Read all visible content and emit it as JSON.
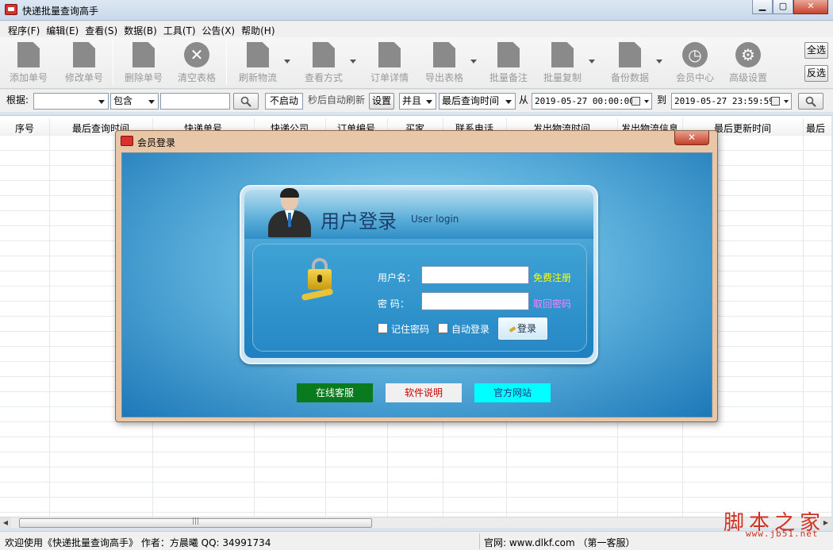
{
  "window": {
    "title": "快递批量查询高手"
  },
  "menu": [
    "程序(F)",
    "编辑(E)",
    "查看(S)",
    "数据(B)",
    "工具(T)",
    "公告(X)",
    "帮助(H)"
  ],
  "toolbar": {
    "add": "添加单号",
    "edit": "修改单号",
    "delete": "删除单号",
    "clear": "清空表格",
    "refresh": "刷新物流",
    "view_mode": "查看方式",
    "order_detail": "订单详情",
    "export": "导出表格",
    "batch_note": "批量备注",
    "batch_copy": "批量复制",
    "backup": "备份数据",
    "member_center": "会员中心",
    "advanced": "高级设置",
    "select_all": "全选",
    "invert": "反选"
  },
  "filter": {
    "by_label": "根据:",
    "field_value": "",
    "match_value": "包含",
    "keyword_value": "",
    "auto_refresh_value": "不启动",
    "auto_refresh_suffix": "秒后自动刷新",
    "settings_button": "设置",
    "logic_value": "并且",
    "time_field_value": "最后查询时间",
    "from_label": "从",
    "from_date": "2019-05-27 00:00:00",
    "to_label": "到",
    "to_date": "2019-05-27 23:59:59"
  },
  "grid": {
    "columns": [
      "序号",
      "最后查询时间",
      "快递单号",
      "快递公司",
      "订单编号",
      "买家",
      "联系电话",
      "发出物流时间",
      "发出物流信息",
      "最后更新时间",
      "最后"
    ]
  },
  "status": {
    "welcome": "欢迎使用《快递批量查询高手》 作者：方晨曦  QQ: 34991734",
    "website": "官网: www.dlkf.com （第一客服）"
  },
  "watermark": {
    "cn": "脚本之家",
    "url": "www.jb51.net"
  },
  "dialog": {
    "title": "会员登录",
    "heading_cn": "用户登录",
    "heading_en": "User login",
    "username_label": "用户名：",
    "password_label": "密  码：",
    "register_link": "免费注册",
    "recover_link": "取回密码",
    "remember_label": "记住密码",
    "autologin_label": "自动登录",
    "login_button": "登录",
    "online_service": "在线客服",
    "manual": "软件说明",
    "official_site": "官方网站"
  },
  "colors": {
    "register_link": "#ffff00",
    "recover_link": "#ff80ff",
    "online_service_bg": "#0a7a1f",
    "manual_bg": "#f0f0f0",
    "manual_text": "#cc0000",
    "official_site_bg": "#00ffff"
  }
}
